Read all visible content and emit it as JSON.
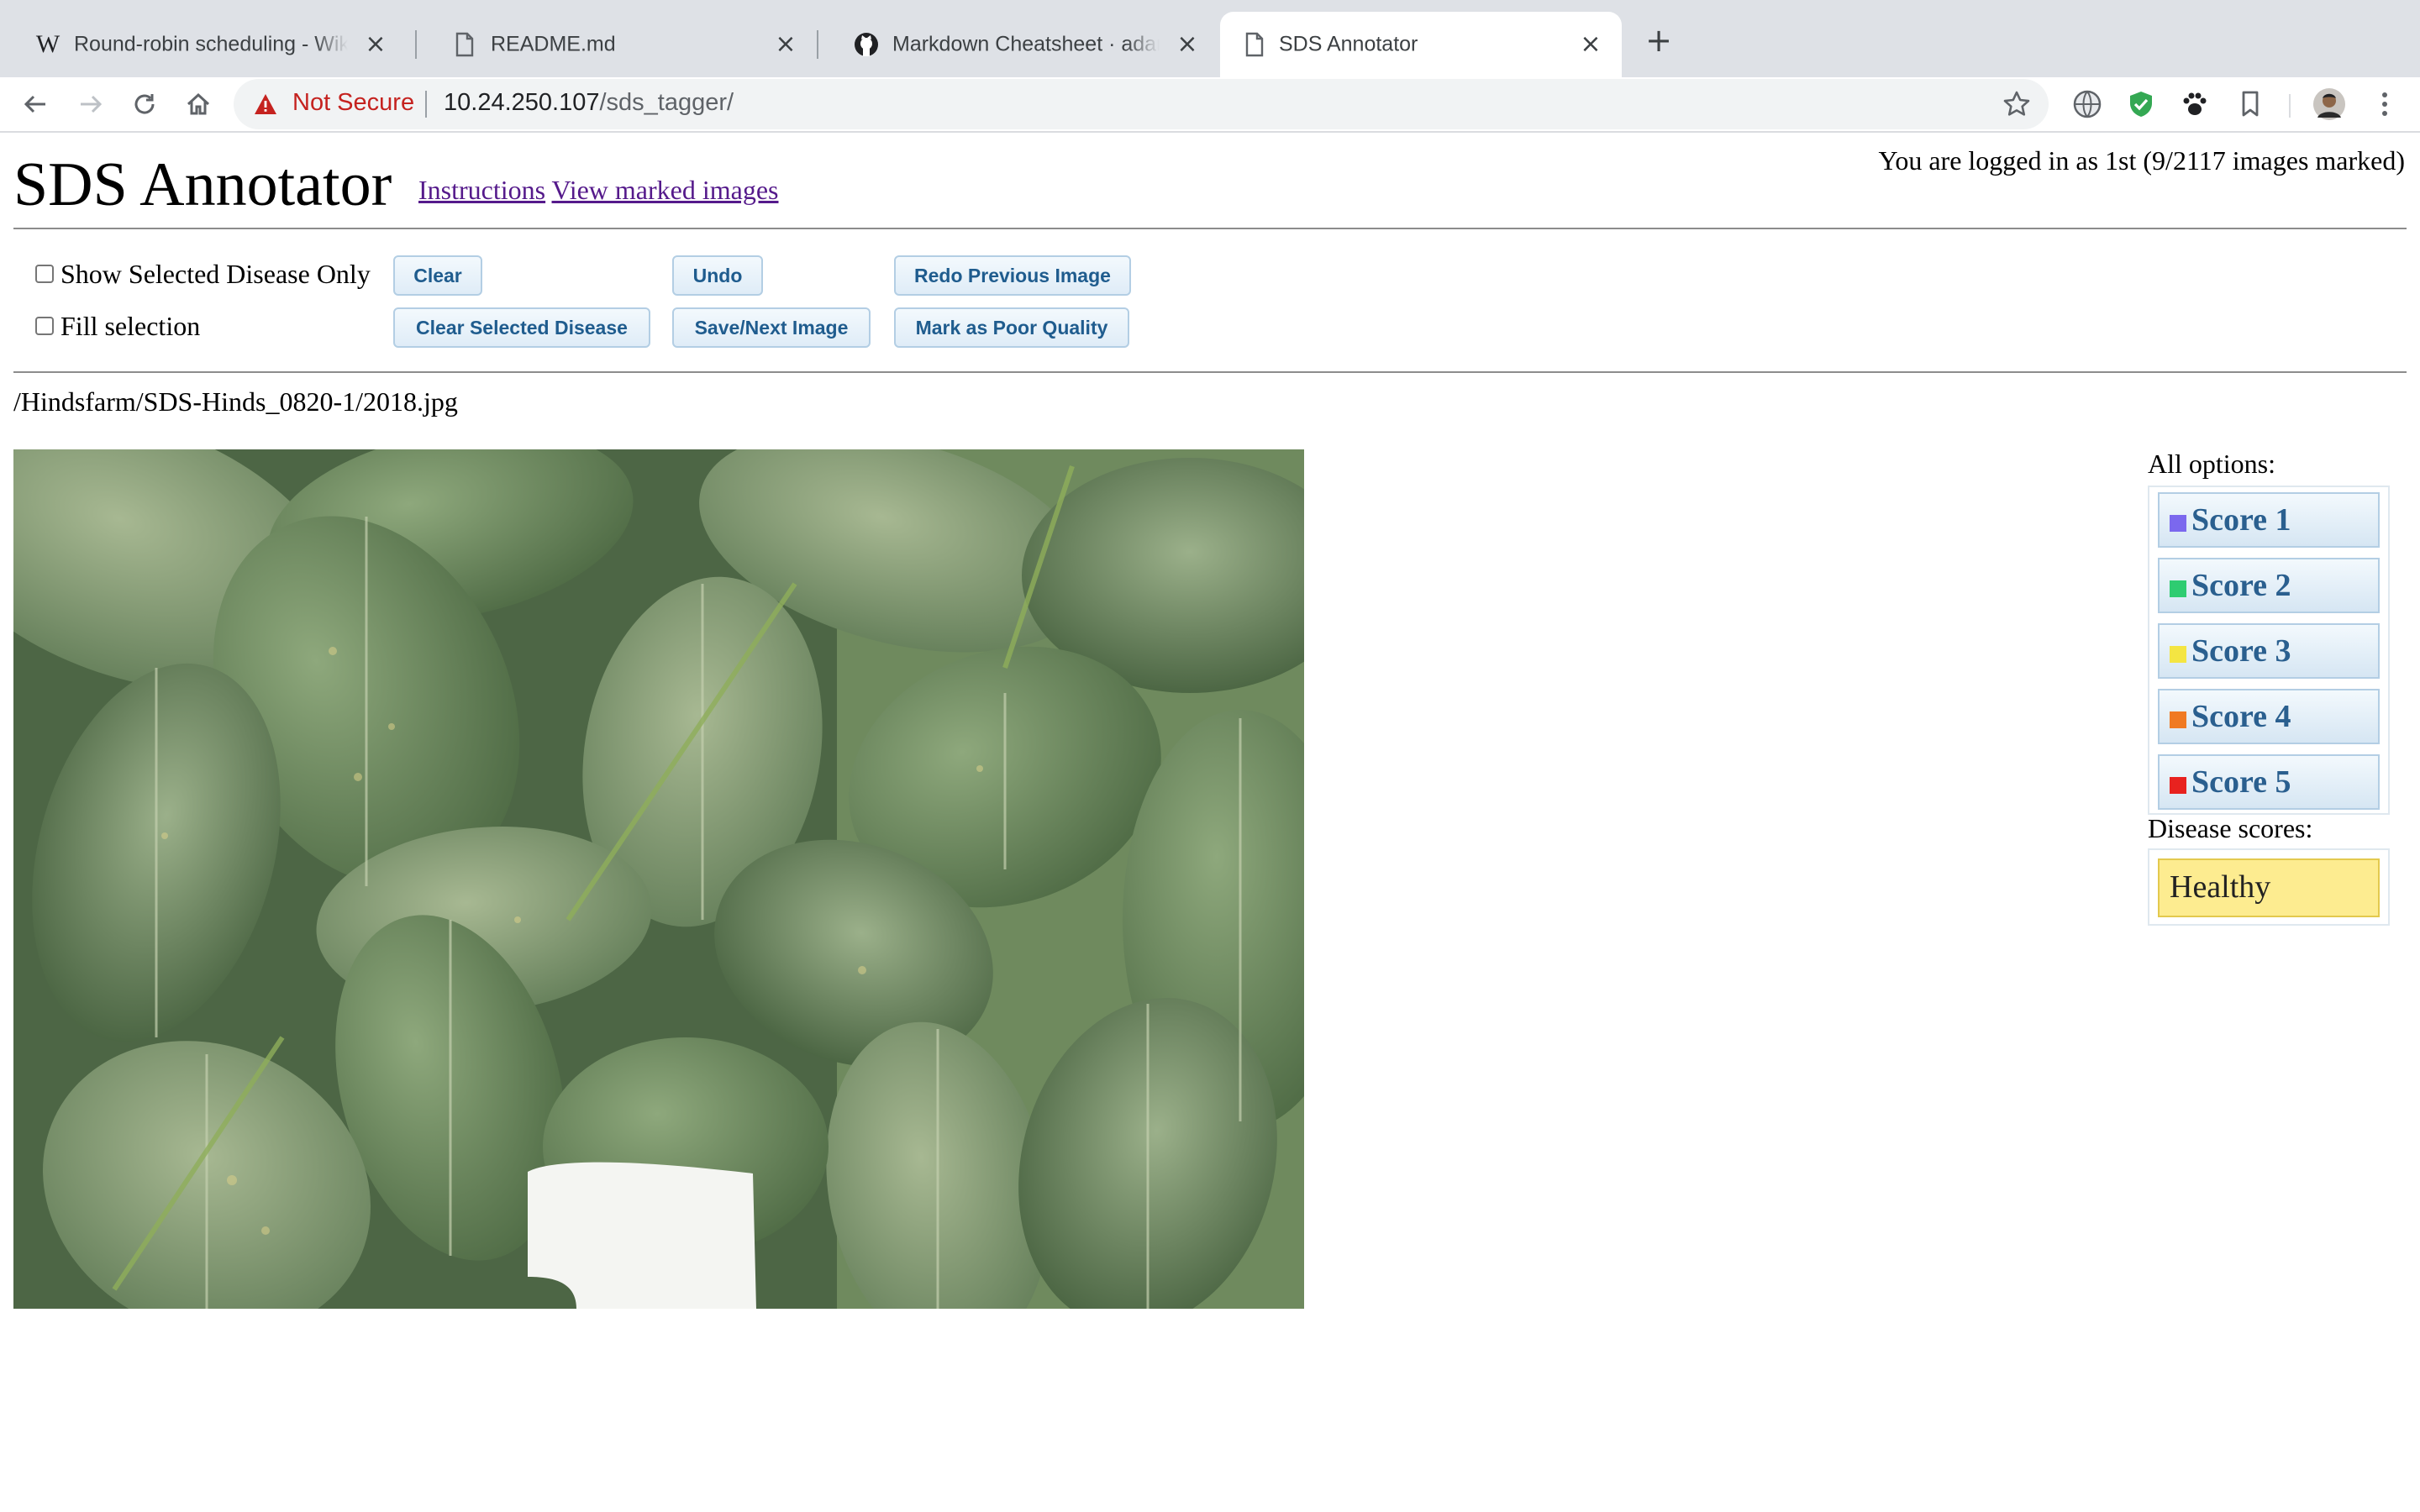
{
  "browser": {
    "tabs": [
      {
        "title": "Round-robin scheduling - Wiki",
        "favicon": "wikipedia-icon",
        "active": false
      },
      {
        "title": "README.md",
        "favicon": "document-icon",
        "active": false
      },
      {
        "title": "Markdown Cheatsheet · adam-",
        "favicon": "github-icon",
        "active": false
      },
      {
        "title": "SDS Annotator",
        "favicon": "document-icon",
        "active": true
      }
    ],
    "security_label": "Not Secure",
    "url_host": "10.24.250.107",
    "url_path": "/sds_tagger/",
    "security_color": "#c5221f",
    "extension_colors": {
      "shield": "#34a853"
    }
  },
  "app": {
    "title": "SDS Annotator",
    "links": [
      "Instructions",
      "View marked images"
    ],
    "login_status": "You are logged in as 1st (9/2117 images marked)",
    "checkboxes": [
      "Show Selected Disease Only",
      "Fill selection"
    ],
    "buttons": {
      "clear": "Clear",
      "undo": "Undo",
      "redo_previous": "Redo Previous Image",
      "clear_selected": "Clear Selected Disease",
      "save_next": "Save/Next Image",
      "mark_poor": "Mark as Poor Quality"
    },
    "file_path": "/Hindsfarm/SDS-Hinds_0820-1/2018.jpg",
    "options_label": "All options:",
    "options": [
      {
        "label": "Score 1",
        "color": "#7b68ee"
      },
      {
        "label": "Score 2",
        "color": "#2ecc71"
      },
      {
        "label": "Score 3",
        "color": "#f4e542"
      },
      {
        "label": "Score 4",
        "color": "#f07a22"
      },
      {
        "label": "Score 5",
        "color": "#e8221f"
      }
    ],
    "disease_scores_label": "Disease scores:",
    "current_score": "Healthy",
    "accent_link_color": "#551a8b",
    "button_text_color": "#1f5c8e"
  }
}
